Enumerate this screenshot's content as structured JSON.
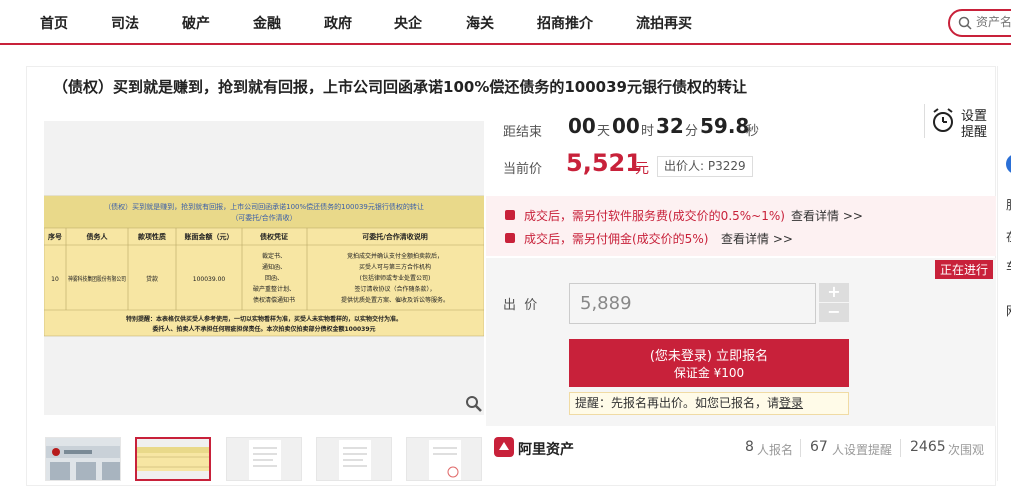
{
  "nav": [
    "首页",
    "司法",
    "破产",
    "金融",
    "政府",
    "央企",
    "海关",
    "招商推介",
    "流拍再买"
  ],
  "search": {
    "placeholder": "资产名"
  },
  "title": "（债权）买到就是赚到，抢到就有回报，上市公司回函承诺100%偿还债务的100039元银行债权的转让",
  "doc": {
    "heading": "（债权）买到就是赚到，抢到就有回报，上市公司回函承诺100%偿还债务的100039元银行债权的转让",
    "subheading": "（可委托/合作清收）",
    "columns": [
      "序号",
      "债务人",
      "款项性质",
      "账面金额（元）",
      "债权凭证",
      "可委托/合作清收说明"
    ],
    "row": {
      "no": "10",
      "debtor": "神雾科技集团股份有限公司",
      "type": "贷款",
      "amount": "100039.00",
      "proof": [
        "裁定书、",
        "通知函、",
        "回函、",
        "破产重整计划、",
        "债权清偿通知书"
      ],
      "note": [
        "竞拍成交并确认支付全额拍卖款后，",
        "买受人可与第三方合作机构",
        "(包括律师或专业处置公司)",
        "签订清收协议（合作随条款），",
        "提供优质处置方案、催收及诉讼等服务。"
      ]
    },
    "footer": [
      "特别提醒：本表格仅供买受人参考使用，一切以实物看样为准，买受人未实物看样的，以实物交付为准。",
      "委托人、拍卖人不承担任何瑕疵担保责任。本次拍卖仅拍卖部分债权金额100039元"
    ]
  },
  "countdown": {
    "label": "距结束",
    "days": "00",
    "day_unit": "天",
    "hours": "00",
    "hour_unit": "时",
    "minutes": "32",
    "minute_unit": "分",
    "seconds": "59.8",
    "second_unit": "秒"
  },
  "remind": {
    "line1": "设置",
    "line2": "提醒"
  },
  "price": {
    "label": "当前价",
    "value": "5,521",
    "unit": "元",
    "bidder": "出价人: P3229"
  },
  "fees": [
    {
      "text": "成交后，需另付软件服务费(成交价的0.5%~1%)",
      "link": "查看详情 >>"
    },
    {
      "text": "成交后，需另付佣金(成交价的5%)",
      "link": "查看详情 >>"
    }
  ],
  "status": "正在进行",
  "bid": {
    "label": "出  价",
    "value": "5,889",
    "plus": "+",
    "minus": "−"
  },
  "register": {
    "line1": "(您未登录) 立即报名",
    "line2": "保证金 ¥100"
  },
  "tip": {
    "text": "提醒：先报名再出价。如您已报名，请",
    "link": "登录"
  },
  "brand": "阿里资产",
  "stats": [
    {
      "num": "8",
      "label": "人报名"
    },
    {
      "num": "67",
      "label": "人设置提醒"
    },
    {
      "num": "2465",
      "label": "次围观"
    }
  ],
  "right_partial": [
    "服",
    "在",
    "车",
    "网"
  ],
  "colors": {
    "brand": "#c8213a",
    "pink_bg": "#fdf1f2",
    "tip_bg": "#fffbe8"
  }
}
